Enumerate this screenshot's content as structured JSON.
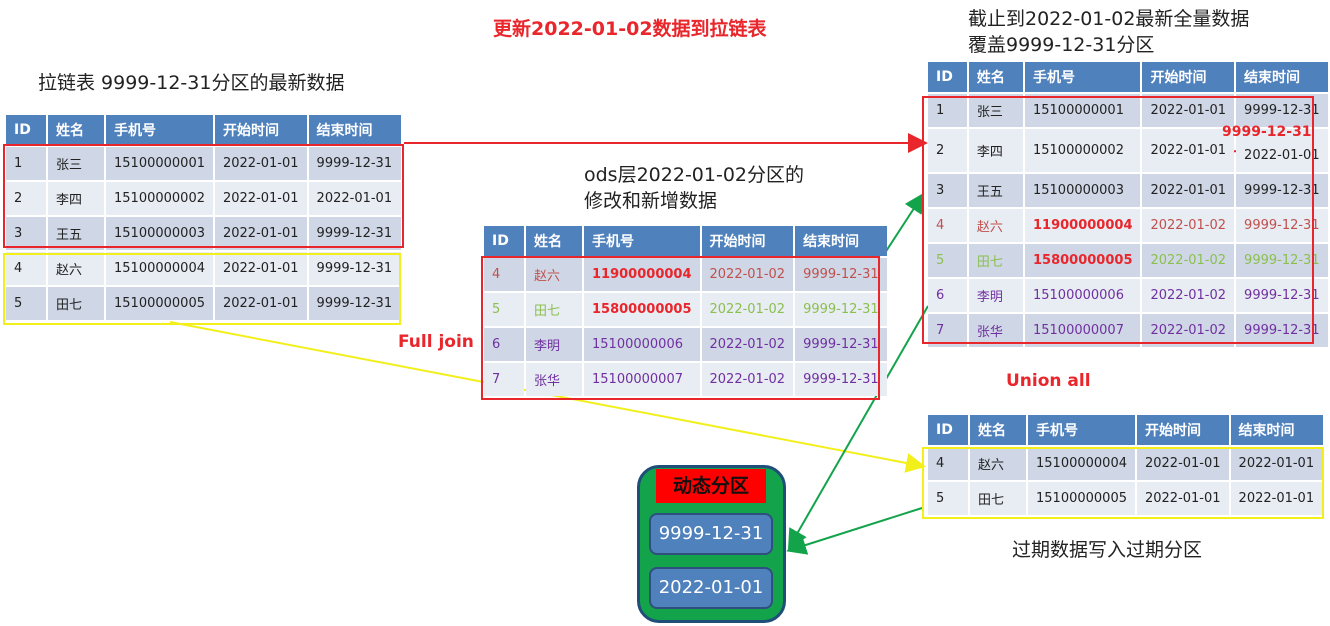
{
  "title": "更新2022-01-02数据到拉链表",
  "left_heading": "拉链表 9999-12-31分区的最新数据",
  "middle_heading_line1": "ods层2022-01-02分区的",
  "middle_heading_line2": "修改和新增数据",
  "right_heading_line1": "截止到2022-01-02最新全量数据",
  "right_heading_line2": "覆盖9999-12-31分区",
  "full_join_label": "Full join",
  "union_all_label": "Union all",
  "expired_label": "过期数据写入过期分区",
  "dynamic_partition": {
    "title": "动态分区",
    "partition_1": "9999-12-31",
    "partition_2": "2022-01-01"
  },
  "columns": [
    "ID",
    "姓名",
    "手机号",
    "开始时间",
    "结束时间"
  ],
  "left_table": [
    [
      "1",
      "张三",
      "15100000001",
      "2022-01-01",
      "9999-12-31"
    ],
    [
      "2",
      "李四",
      "15100000002",
      "2022-01-01",
      "2022-01-01"
    ],
    [
      "3",
      "王五",
      "15100000003",
      "2022-01-01",
      "9999-12-31"
    ],
    [
      "4",
      "赵六",
      "15100000004",
      "2022-01-01",
      "9999-12-31"
    ],
    [
      "5",
      "田七",
      "15100000005",
      "2022-01-01",
      "9999-12-31"
    ]
  ],
  "middle_table": [
    [
      "4",
      "赵六",
      "11900000004",
      "2022-01-02",
      "9999-12-31"
    ],
    [
      "5",
      "田七",
      "15800000005",
      "2022-01-02",
      "9999-12-31"
    ],
    [
      "6",
      "李明",
      "15100000006",
      "2022-01-02",
      "9999-12-31"
    ],
    [
      "7",
      "张华",
      "15100000007",
      "2022-01-02",
      "9999-12-31"
    ]
  ],
  "right_table": [
    [
      "1",
      "张三",
      "15100000001",
      "2022-01-01",
      "9999-12-31"
    ],
    [
      "2",
      "李四",
      "15100000002",
      "2022-01-01",
      "2022-01-01"
    ],
    [
      "3",
      "王五",
      "15100000003",
      "2022-01-01",
      "9999-12-31"
    ],
    [
      "4",
      "赵六",
      "11900000004",
      "2022-01-02",
      "9999-12-31"
    ],
    [
      "5",
      "田七",
      "15800000005",
      "2022-01-02",
      "9999-12-31"
    ],
    [
      "6",
      "李明",
      "15100000006",
      "2022-01-02",
      "9999-12-31"
    ],
    [
      "7",
      "张华",
      "15100000007",
      "2022-01-02",
      "9999-12-31"
    ]
  ],
  "right_table_correction": "9999-12-31",
  "expired_table": [
    [
      "4",
      "赵六",
      "15100000004",
      "2022-01-01",
      "2022-01-01"
    ],
    [
      "5",
      "田七",
      "15100000005",
      "2022-01-01",
      "2022-01-01"
    ]
  ],
  "colors": {
    "header_blue": "#4f81bd",
    "highlight_red": "#e8262b",
    "highlight_yellow": "#f2ef1a",
    "arrow_green": "#13a34b",
    "modified_rust": "#c0504d",
    "modified_green": "#8bbf4f",
    "new_purple": "#7030a0"
  }
}
